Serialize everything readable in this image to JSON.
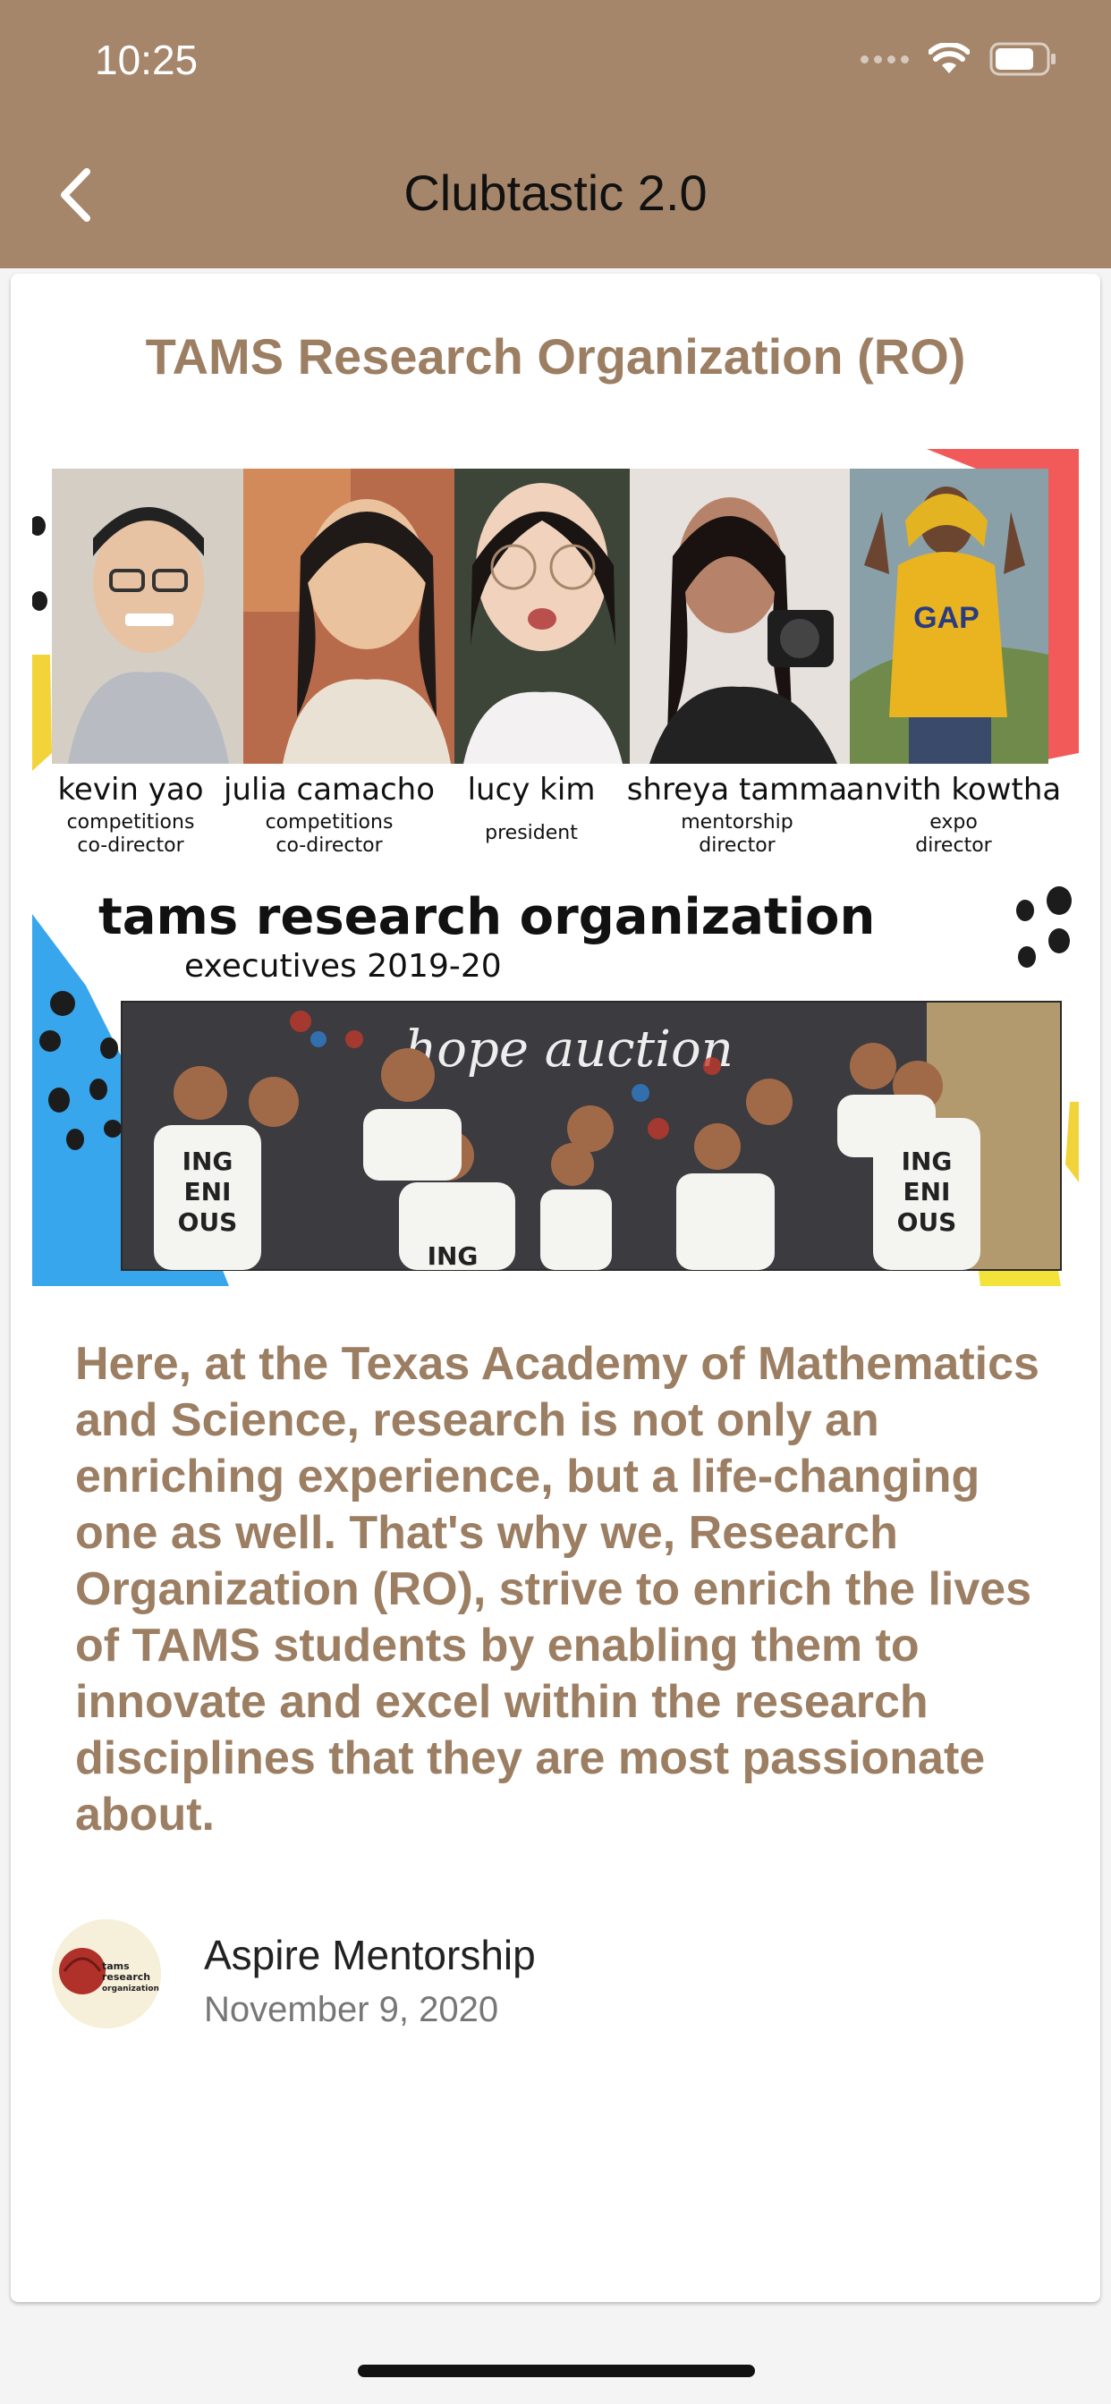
{
  "status_bar": {
    "time": "10:25",
    "icons": [
      "cellular-signal-icon",
      "wifi-icon",
      "battery-icon"
    ]
  },
  "nav": {
    "back_icon": "chevron-left-icon",
    "title": "Clubtastic 2.0"
  },
  "club": {
    "name": "TAMS Research Organization (RO)",
    "image": {
      "executives": [
        {
          "name": "kevin yao",
          "role_line1": "competitions",
          "role_line2": "co-director"
        },
        {
          "name": "julia camacho",
          "role_line1": "competitions",
          "role_line2": "co-director"
        },
        {
          "name": "lucy kim",
          "role_line1": "president",
          "role_line2": ""
        },
        {
          "name": "shreya tamma",
          "role_line1": "mentorship",
          "role_line2": "director"
        },
        {
          "name": "anvith kowtha",
          "role_line1": "expo",
          "role_line2": "director"
        }
      ],
      "org_name": "tams research organization",
      "org_subtitle": "executives 2019-20",
      "backdrop_text": "hope auction",
      "shirt_text": "ING ENI OUS"
    },
    "description": "Here, at the Texas Academy of Mathematics and Science, research is not only an enriching experience, but a life-changing one as well. That's why we, Research Organization (RO), strive to enrich the lives of TAMS students by enabling them to innovate and excel within the research disciplines that they are most passionate about."
  },
  "author": {
    "name": "Aspire Mentorship",
    "date": "November 9, 2020",
    "avatar_text": "tams research organization."
  },
  "colors": {
    "header_bg": "#a5866a",
    "accent_text": "#9c7e63",
    "card_bg": "#ffffff"
  }
}
